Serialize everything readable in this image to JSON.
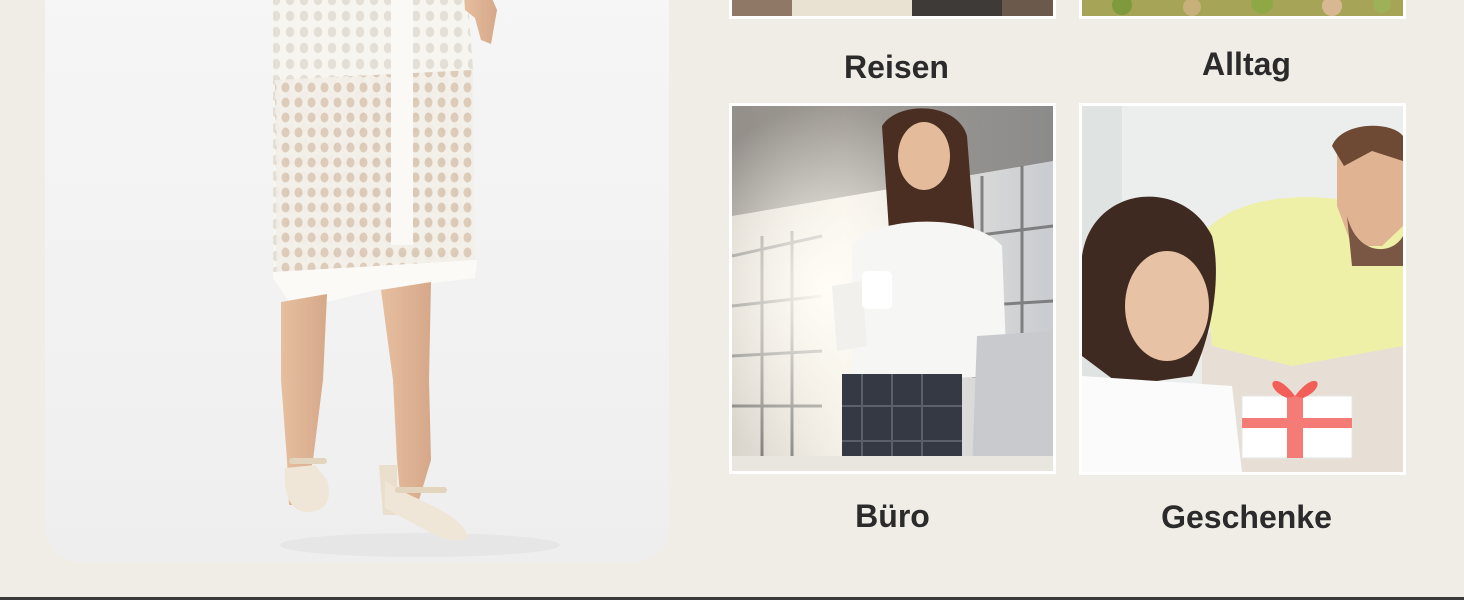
{
  "hero": {
    "icon": "woman-in-white-knit-dress-photo"
  },
  "categories": [
    {
      "label": "Reisen",
      "icon": "travel-photo"
    },
    {
      "label": "Alltag",
      "icon": "everyday-photo"
    },
    {
      "label": "Büro",
      "icon": "office-woman-photo"
    },
    {
      "label": "Geschenke",
      "icon": "gift-couple-photo"
    }
  ],
  "colors": {
    "background": "#f0ede6",
    "caption_text": "#2b2b2b",
    "tile_border": "#ffffff"
  }
}
